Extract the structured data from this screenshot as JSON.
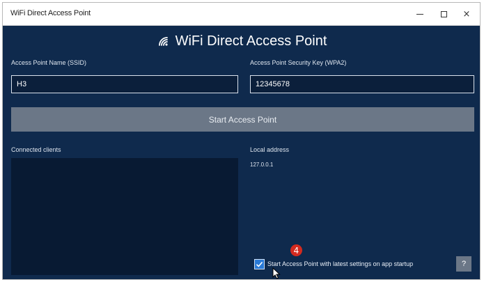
{
  "window": {
    "title": "WiFi Direct Access Point",
    "min_glyph": "",
    "max_glyph": "",
    "close_glyph": "×"
  },
  "header": {
    "title": "WiFi Direct Access Point",
    "icon": "wifi-icon"
  },
  "ssid": {
    "label": "Access Point Name (SSID)",
    "value": "H3"
  },
  "key": {
    "label": "Access Point Security Key (WPA2)",
    "value": "12345678"
  },
  "start_button": {
    "label": "Start Access Point"
  },
  "clients": {
    "label": "Connected clients"
  },
  "local": {
    "label": "Local address",
    "value": "127.0.0.1"
  },
  "startup": {
    "checked": true,
    "label": "Start Access Point with latest settings on app startup"
  },
  "help": {
    "label": "?"
  },
  "annotation": {
    "marker": "4"
  },
  "colors": {
    "background": "#0f2a4d",
    "button": "#6b7787",
    "checkbox": "#2a7ad6",
    "marker": "#d42a1f"
  }
}
